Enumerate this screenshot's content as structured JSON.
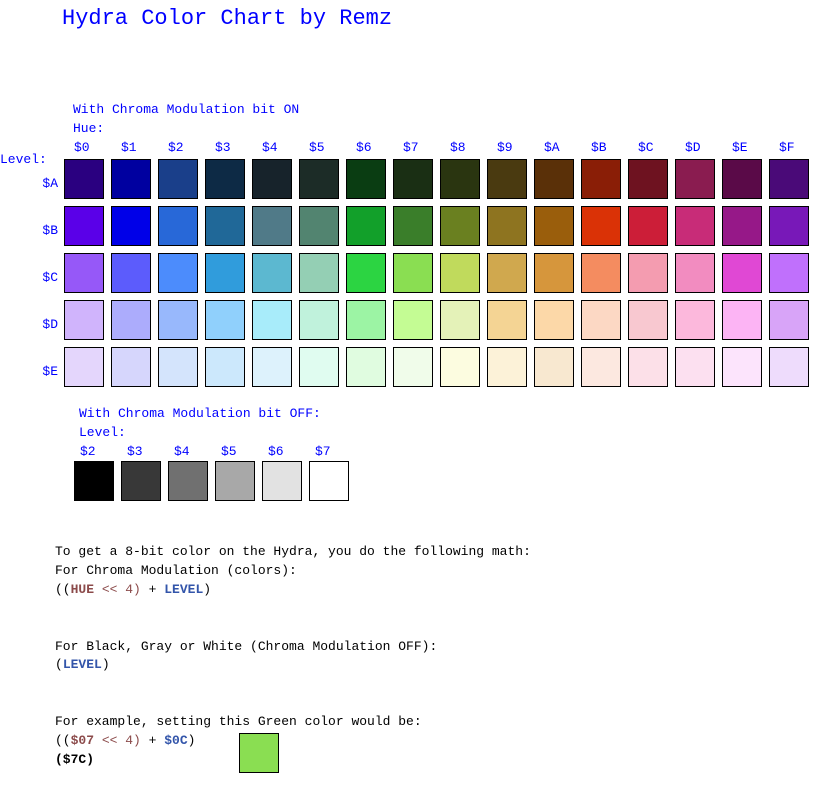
{
  "title": "Hydra Color Chart by Remz",
  "chroma_on": {
    "heading": "With Chroma Modulation bit ON",
    "hue_label": "Hue:",
    "level_label": "Level:",
    "hues": [
      "$0",
      "$1",
      "$2",
      "$3",
      "$4",
      "$5",
      "$6",
      "$7",
      "$8",
      "$9",
      "$A",
      "$B",
      "$C",
      "$D",
      "$E",
      "$F"
    ],
    "rows": [
      {
        "level": "$A",
        "colors": [
          "#2a0080",
          "#0000a0",
          "#1a3f8a",
          "#0d2a45",
          "#17232b",
          "#1c2c27",
          "#0a3d12",
          "#1a2f14",
          "#2a3510",
          "#4a3a10",
          "#5a3008",
          "#8a1e06",
          "#6e1220",
          "#8a1c50",
          "#5a0a48",
          "#4a0a78"
        ]
      },
      {
        "level": "$B",
        "colors": [
          "#5a00e8",
          "#0000e8",
          "#2868d8",
          "#206898",
          "#507a88",
          "#528470",
          "#12a02a",
          "#3a7e2a",
          "#6a8020",
          "#8e7420",
          "#9a5e0c",
          "#da3206",
          "#cc1e38",
          "#c82c78",
          "#961888",
          "#7818b8"
        ]
      },
      {
        "level": "$C",
        "colors": [
          "#9658f8",
          "#5c5cfc",
          "#4c8cfc",
          "#309cdc",
          "#5cb8d0",
          "#94cfb4",
          "#2cd442",
          "#8ade52",
          "#c0da5c",
          "#d0a84e",
          "#d6963c",
          "#f48c60",
          "#f49cb0",
          "#f28cc0",
          "#e048d4",
          "#c070fc"
        ]
      },
      {
        "level": "$D",
        "colors": [
          "#d0b4fc",
          "#acacfc",
          "#98b8fc",
          "#90d0fc",
          "#a8ecfa",
          "#c0f2dc",
          "#9cf4a4",
          "#c4fc94",
          "#e4f2b8",
          "#f4d494",
          "#fcd8a8",
          "#fcd8c4",
          "#f8c8d0",
          "#fcb8dc",
          "#fcb4f4",
          "#d8a4f8"
        ]
      },
      {
        "level": "$E",
        "colors": [
          "#e4d6fc",
          "#d6d6fc",
          "#d4e4fc",
          "#cce8fc",
          "#ddf2fc",
          "#e0fcf0",
          "#e0fce0",
          "#f0fcea",
          "#fcfce0",
          "#fcf2d8",
          "#f8e8d0",
          "#fce8e0",
          "#fce0e8",
          "#fce0f0",
          "#fce4fc",
          "#eedcfc"
        ]
      }
    ]
  },
  "chroma_off": {
    "heading": "With Chroma Modulation bit OFF:",
    "level_label": "Level:",
    "levels": [
      {
        "level": "$2",
        "color": "#000000"
      },
      {
        "level": "$3",
        "color": "#383838"
      },
      {
        "level": "$4",
        "color": "#707070"
      },
      {
        "level": "$5",
        "color": "#a8a8a8"
      },
      {
        "level": "$6",
        "color": "#e2e2e2"
      },
      {
        "level": "$7",
        "color": "#ffffff"
      }
    ]
  },
  "explanation": {
    "line1": "To get a 8-bit color on the Hydra, you do the following math:",
    "line2": "For Chroma Modulation (colors):",
    "formula1": {
      "open": "((",
      "hue": "HUE",
      "shift": " << 4)",
      "plus": " + ",
      "level": "LEVEL",
      "close": ")"
    },
    "line3": "For Black, Gray or White (Chroma Modulation OFF):",
    "formula2": {
      "open": "(",
      "level": "LEVEL",
      "close": ")"
    },
    "line4": "For example, setting this Green color would be:",
    "example": {
      "open": "((",
      "hue": "$07",
      "shift": " << 4)",
      "plus": " + ",
      "level": "$0C",
      "close": ")",
      "result": "($7C)",
      "swatch_color": "#8ade52"
    }
  }
}
